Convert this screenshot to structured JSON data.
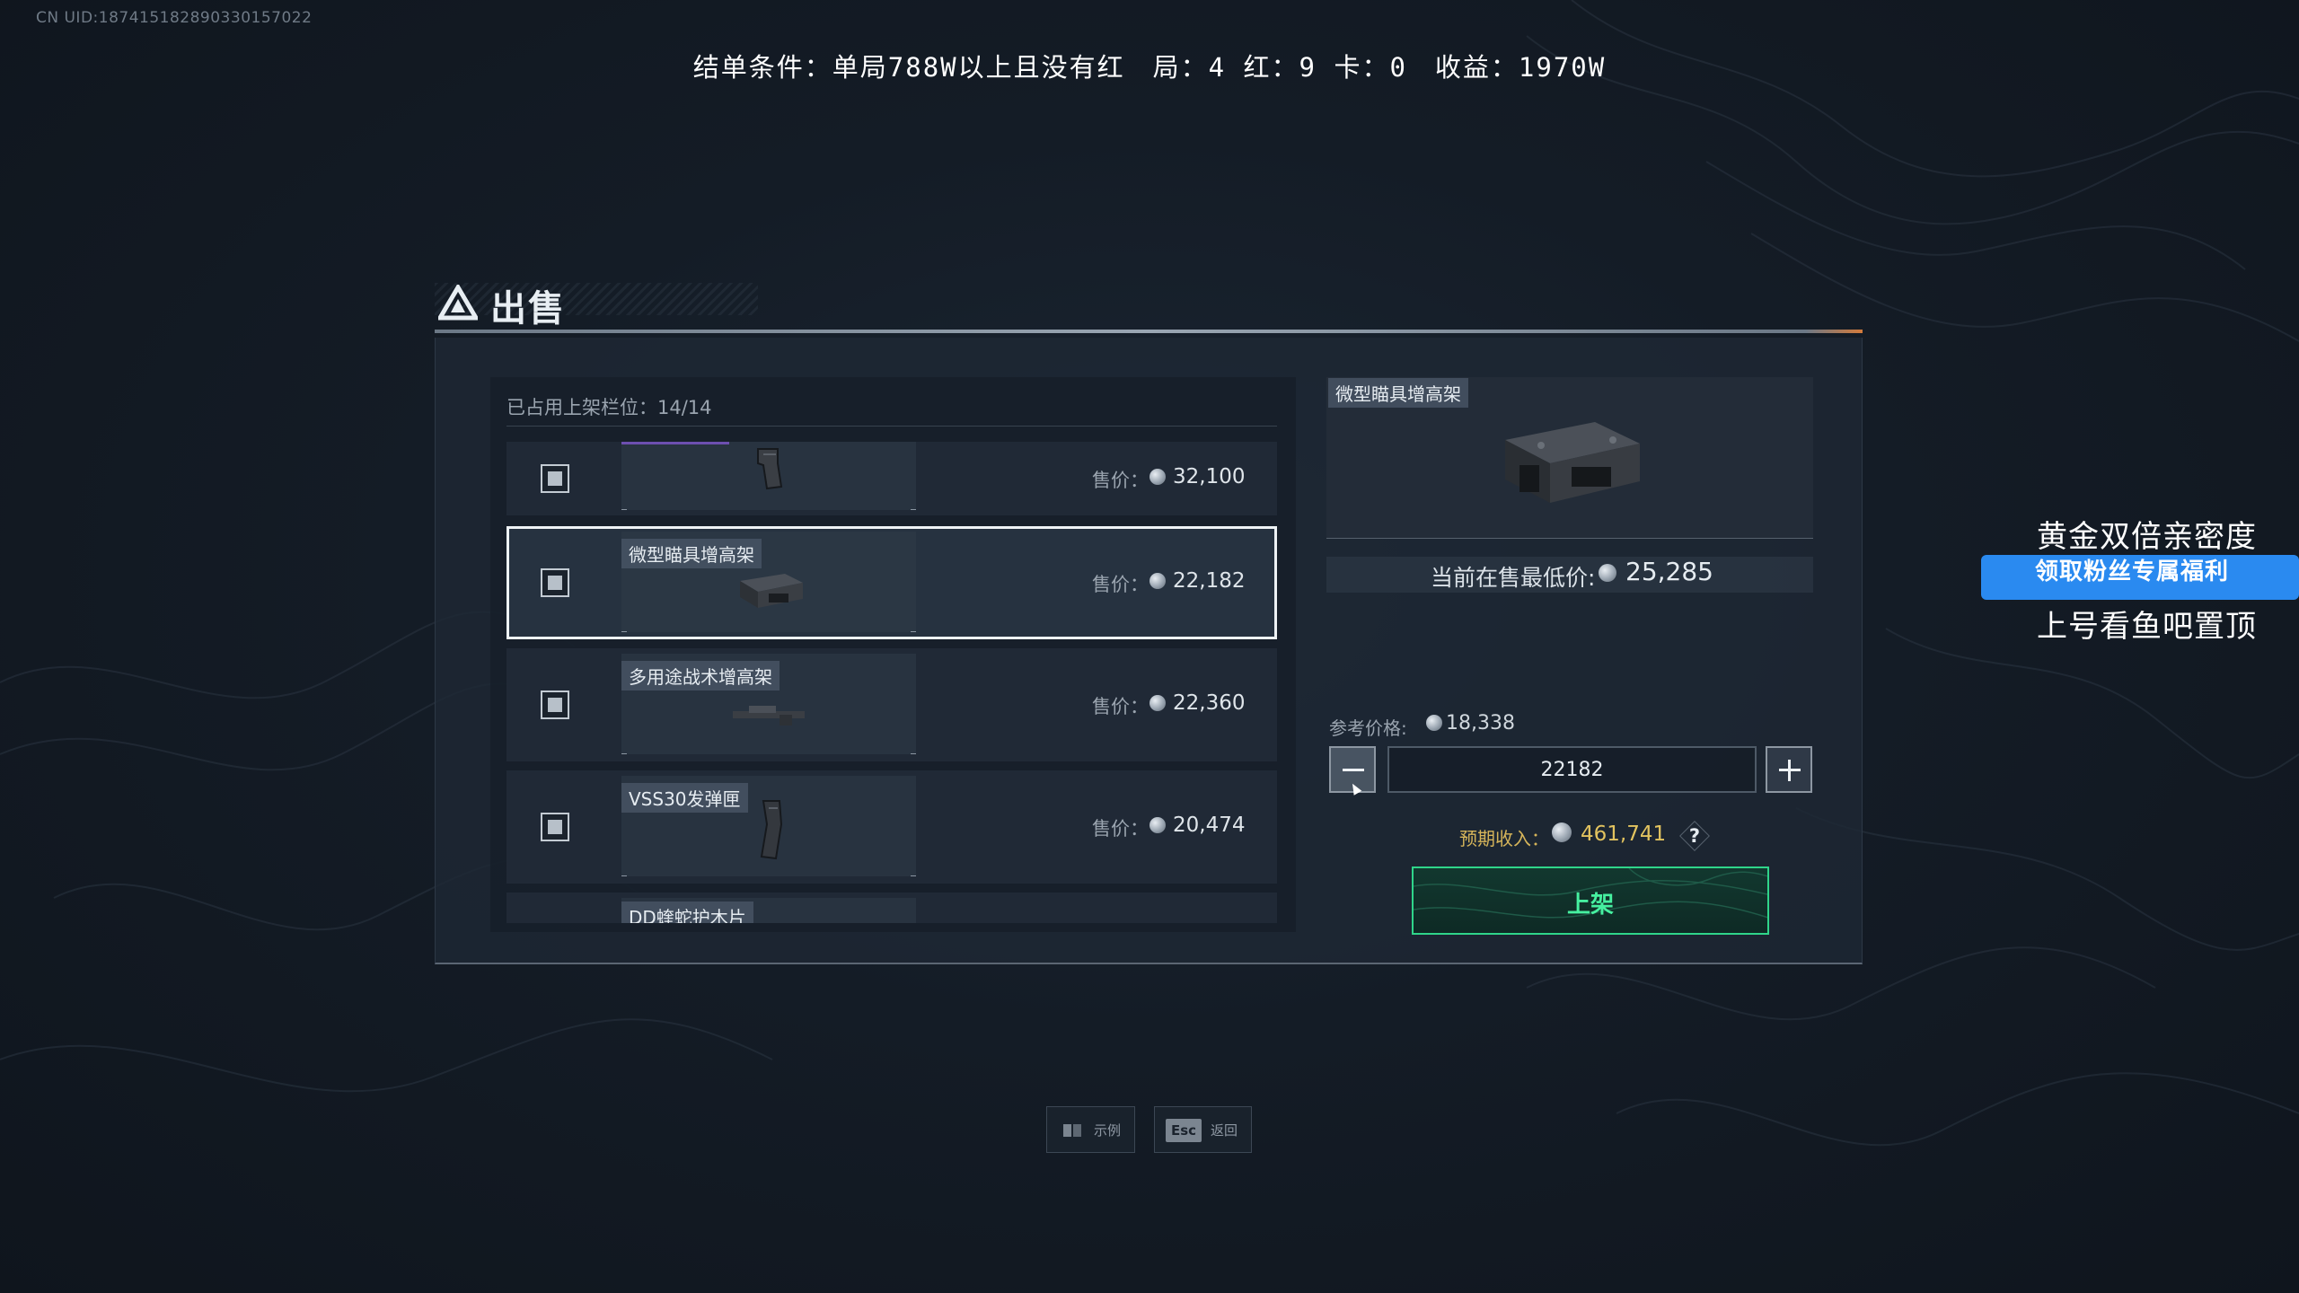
{
  "uid_text": "CN UID:1874151828903301570​22",
  "overlay_banner": "结单条件：单局788W以上且没有红　局：4 红：9 卡：0　收益：1970W",
  "sell_panel": {
    "title": "出售",
    "slots_label": "已占用上架栏位：14/14",
    "items": [
      {
        "name": "",
        "price_label": "售价：",
        "price": "32,100",
        "selected": false
      },
      {
        "name": "微型瞄具增高架",
        "price_label": "售价：",
        "price": "22,182",
        "selected": true
      },
      {
        "name": "多用途战术增高架",
        "price_label": "售价：",
        "price": "22,360",
        "selected": false
      },
      {
        "name": "VSS30发弹匣",
        "price_label": "售价：",
        "price": "20,474",
        "selected": false
      },
      {
        "name": "DD蝰蛇护木片",
        "price_label": "",
        "price": "",
        "selected": false
      }
    ]
  },
  "detail": {
    "item_name": "微型瞄具增高架",
    "lowest_label": "当前在售最低价:",
    "lowest_price": "25,285",
    "ref_label": "参考价格:",
    "ref_price": "18,338",
    "price_input_value": "22182",
    "income_label": "预期收入：",
    "income_value": "461,741",
    "help_glyph": "?",
    "list_button_label": "上架"
  },
  "bottom_bar": {
    "example_label": "示例",
    "back_key": "Esc",
    "back_label": "返回"
  },
  "promo": {
    "line1": "黄金双倍亲密度",
    "line2": "领取粉丝专属福利",
    "line3": "上号看鱼吧置顶"
  },
  "colors": {
    "accent_green": "#2fd58a",
    "income_gold": "#e2c35f",
    "promo_blue": "#2a8af0"
  }
}
